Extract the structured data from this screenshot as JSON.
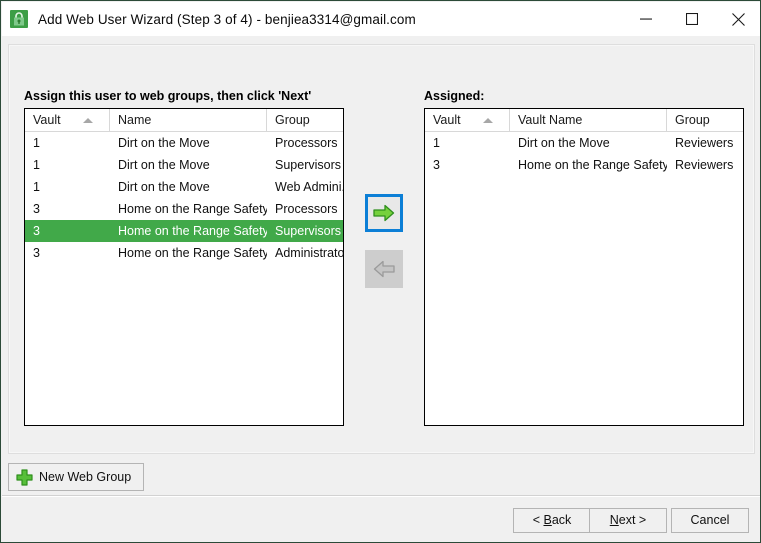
{
  "window": {
    "title": "Add Web User Wizard (Step 3 of 4) - benjiea3314@gmail.com",
    "app_icon": "green-padlock-icon",
    "controls": {
      "minimize": "minimize-icon",
      "maximize": "maximize-icon",
      "close": "close-icon"
    },
    "border_color": "#2c4a38"
  },
  "left_panel": {
    "heading": "Assign this user to web groups, then click 'Next'",
    "columns": [
      "Vault",
      "Name",
      "Group"
    ],
    "sort_column": "Vault",
    "sort_direction": "ascending",
    "rows": [
      {
        "vault": "1",
        "name": "Dirt on the Move",
        "group": "Processors",
        "selected": false
      },
      {
        "vault": "1",
        "name": "Dirt on the Move",
        "group": "Supervisors",
        "selected": false
      },
      {
        "vault": "1",
        "name": "Dirt on the Move",
        "group": "Web Admini...",
        "selected": false
      },
      {
        "vault": "3",
        "name": "Home on the Range Safety",
        "group": "Processors",
        "selected": false
      },
      {
        "vault": "3",
        "name": "Home on the Range Safety",
        "group": "Supervisors",
        "selected": true
      },
      {
        "vault": "3",
        "name": "Home on the Range Safety",
        "group": "Administrators",
        "selected": false
      }
    ]
  },
  "right_panel": {
    "heading": "Assigned:",
    "columns": [
      "Vault",
      "Vault Name",
      "Group"
    ],
    "sort_column": "Vault",
    "sort_direction": "ascending",
    "rows": [
      {
        "vault": "1",
        "name": "Dirt on the Move",
        "group": "Reviewers"
      },
      {
        "vault": "3",
        "name": "Home on the Range Safety",
        "group": "Reviewers"
      }
    ]
  },
  "transfer": {
    "assign_icon": "arrow-right-icon",
    "assign_enabled": true,
    "assign_focused": true,
    "unassign_icon": "arrow-left-icon",
    "unassign_enabled": false
  },
  "toolbar": {
    "new_group_label": "New Web Group",
    "new_group_icon": "green-plus-icon"
  },
  "footer": {
    "back_label": "< Back",
    "back_mnemonic": "B",
    "next_label": "Next >",
    "next_mnemonic": "N",
    "cancel_label": "Cancel"
  },
  "colors": {
    "selection_green": "#41a949",
    "focus_blue": "#0c7fd6",
    "arrow_green": "#66cc33",
    "panel_gray": "#f0f0f0"
  }
}
